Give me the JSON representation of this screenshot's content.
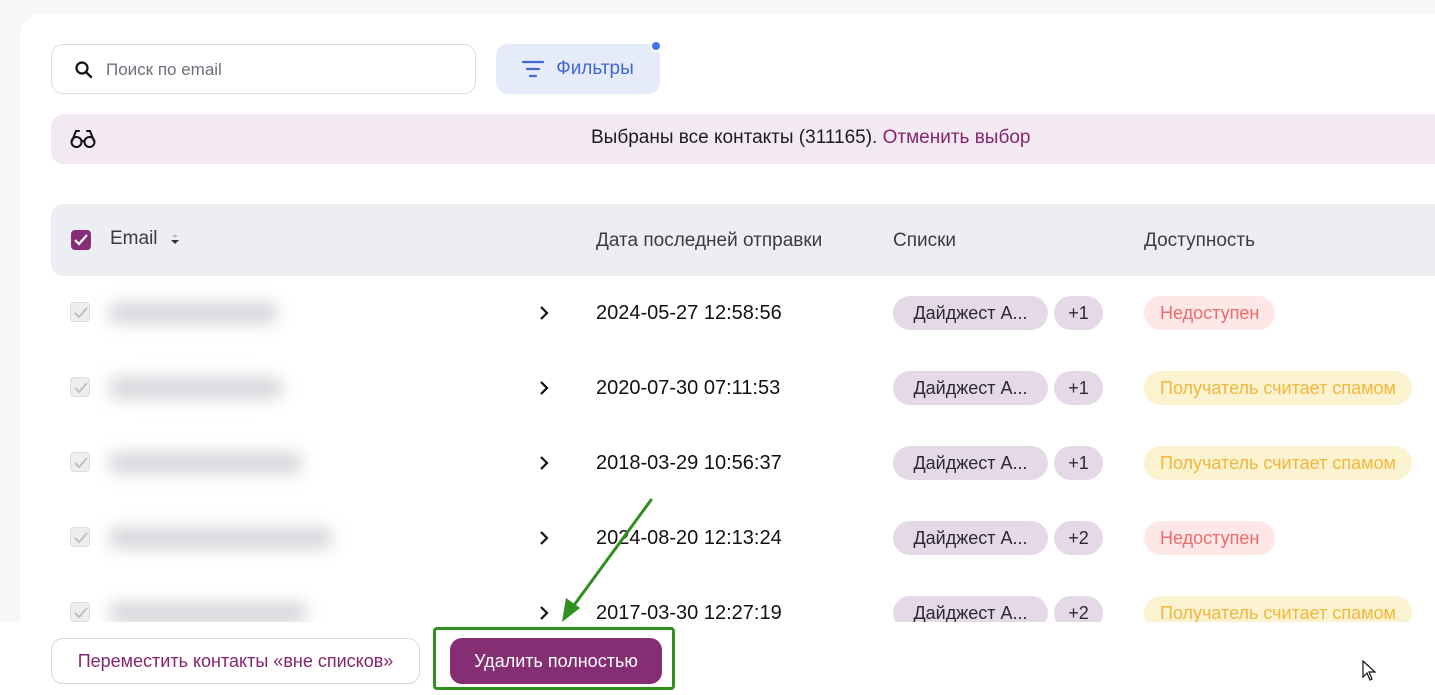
{
  "search": {
    "placeholder": "Поиск по email",
    "value": ""
  },
  "filters": {
    "label": "Фильтры"
  },
  "banner": {
    "text": "Выбраны все контакты (311165).",
    "cancel": "Отменить выбор"
  },
  "table": {
    "columns": [
      "Email",
      "Дата последней отправки",
      "Списки",
      "Доступность"
    ],
    "rows": [
      {
        "date": "2024-05-27 12:58:56",
        "list": "Дайджест А...",
        "extra": "+1",
        "status": "Недоступен",
        "status_kind": "red"
      },
      {
        "date": "2020-07-30 07:11:53",
        "list": "Дайджест А...",
        "extra": "+1",
        "status": "Получатель считает спамом",
        "status_kind": "yellow"
      },
      {
        "date": "2018-03-29 10:56:37",
        "list": "Дайджест А...",
        "extra": "+1",
        "status": "Получатель считает спамом",
        "status_kind": "yellow"
      },
      {
        "date": "2024-08-20 12:13:24",
        "list": "Дайджест А...",
        "extra": "+2",
        "status": "Недоступен",
        "status_kind": "red"
      },
      {
        "date": "2017-03-30 12:27:19",
        "list": "Дайджест А...",
        "extra": "+2",
        "status": "Получатель считает спамом",
        "status_kind": "yellow"
      }
    ]
  },
  "footer": {
    "move_label": "Переместить контакты «вне списков»",
    "delete_label": "Удалить полностью"
  },
  "colors": {
    "accent": "#862e73",
    "filter_blue": "#3f68d1",
    "status_red": "#ee6b6b",
    "status_yellow": "#f1b73d",
    "annotation_green": "#2f8f1f"
  }
}
